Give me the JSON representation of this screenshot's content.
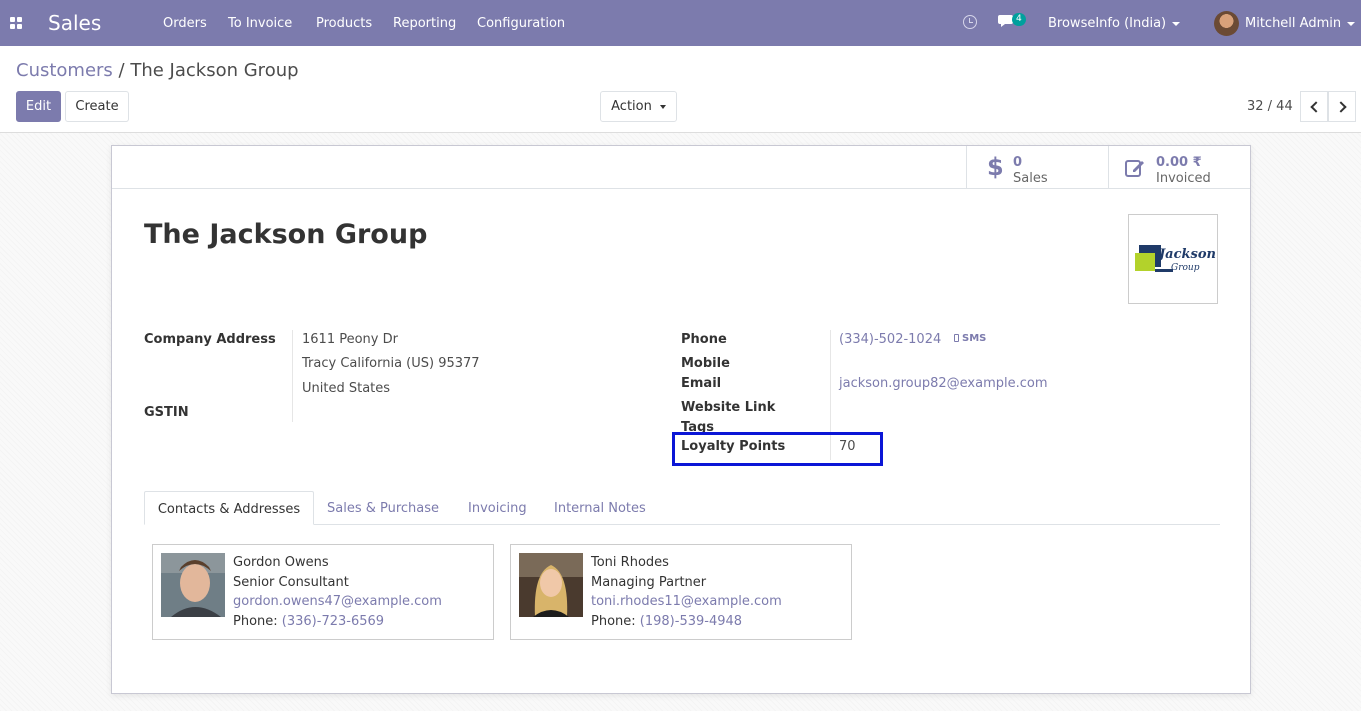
{
  "navbar": {
    "app_name": "Sales",
    "menu": [
      "Orders",
      "To Invoice",
      "Products",
      "Reporting",
      "Configuration"
    ],
    "chat_count": "4",
    "company": "BrowseInfo (India)",
    "user": "Mitchell Admin",
    "icons": [
      "apps-grid-icon",
      "clock-icon",
      "chat-icon"
    ]
  },
  "breadcrumb": {
    "parent": "Customers",
    "separator": "/",
    "current": "The Jackson Group"
  },
  "toolbar": {
    "edit_label": "Edit",
    "create_label": "Create",
    "action_label": "Action",
    "pager": "32 / 44"
  },
  "stats": {
    "sales_value": "0",
    "sales_label": "Sales",
    "invoiced_value": "0.00 ₹",
    "invoiced_label": "Invoiced"
  },
  "partner": {
    "name": "The Jackson Group",
    "logo_text_1": "Jackson",
    "logo_text_2": "Group"
  },
  "fields": {
    "company_address_label": "Company Address",
    "address_line1": "1611 Peony Dr",
    "address_line2": "Tracy California (US) 95377",
    "address_line3": "United States",
    "gstin_label": "GSTIN",
    "phone_label": "Phone",
    "phone_value": "(334)-502-1024",
    "sms_label": "SMS",
    "mobile_label": "Mobile",
    "email_label": "Email",
    "email_value": "jackson.group82@example.com",
    "website_label": "Website Link",
    "tags_label": "Tags",
    "loyalty_label": "Loyalty Points",
    "loyalty_value": "70"
  },
  "tabs": [
    "Contacts & Addresses",
    "Sales & Purchase",
    "Invoicing",
    "Internal Notes"
  ],
  "contacts": [
    {
      "name": "Gordon Owens",
      "title": "Senior Consultant",
      "email": "gordon.owens47@example.com",
      "phone_label": "Phone:",
      "phone": "(336)-723-6569"
    },
    {
      "name": "Toni Rhodes",
      "title": "Managing Partner",
      "email": "toni.rhodes11@example.com",
      "phone_label": "Phone:",
      "phone": "(198)-539-4948"
    }
  ],
  "colors": {
    "brand": "#7c7bad",
    "highlight": "#0b16d6",
    "badge": "#00a09d"
  }
}
